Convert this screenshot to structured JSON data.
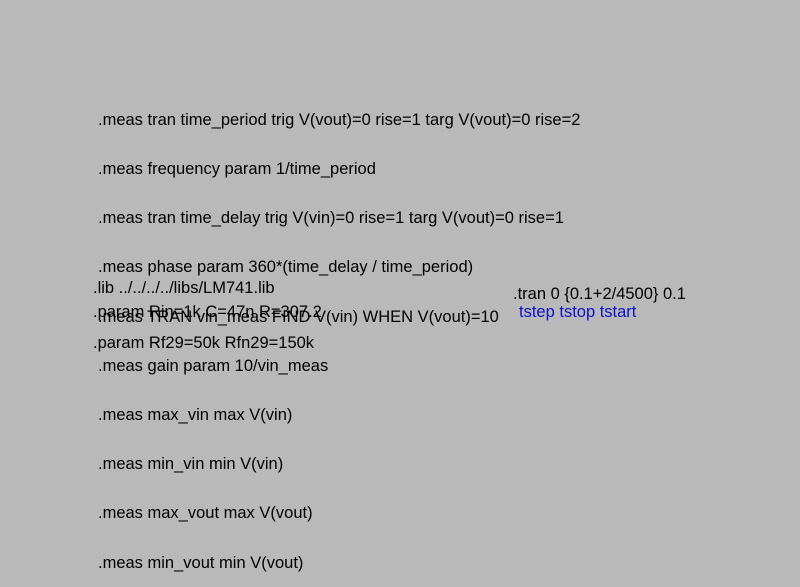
{
  "meas_lines": [
    ".meas tran time_period trig V(vout)=0 rise=1 targ V(vout)=0 rise=2",
    ".meas frequency param 1/time_period",
    ".meas tran time_delay trig V(vin)=0 rise=1 targ V(vout)=0 rise=1",
    ".meas phase param 360*(time_delay / time_period)",
    ".meas TRAN vin_meas FIND V(vin) WHEN V(vout)=10",
    ".meas gain param 10/vin_meas",
    ".meas max_vin max V(vin)",
    ".meas min_vin min V(vin)",
    ".meas max_vout max V(vout)",
    ".meas min_vout min V(vout)"
  ],
  "lib_directive": ".lib ../../../../libs/LM741.lib",
  "param_directive_1": ".param Rin=1k C=47n R=307.2",
  "param_directive_2": ".param Rf29=50k Rfn29=150k",
  "tran_directive": ".tran 0 {0.1+2/4500} 0.1",
  "tran_hint": "tstep tstop tstart",
  "colors": {
    "background": "#b9b9b9",
    "directive_text": "#000000",
    "hint_text": "#1010c8"
  }
}
